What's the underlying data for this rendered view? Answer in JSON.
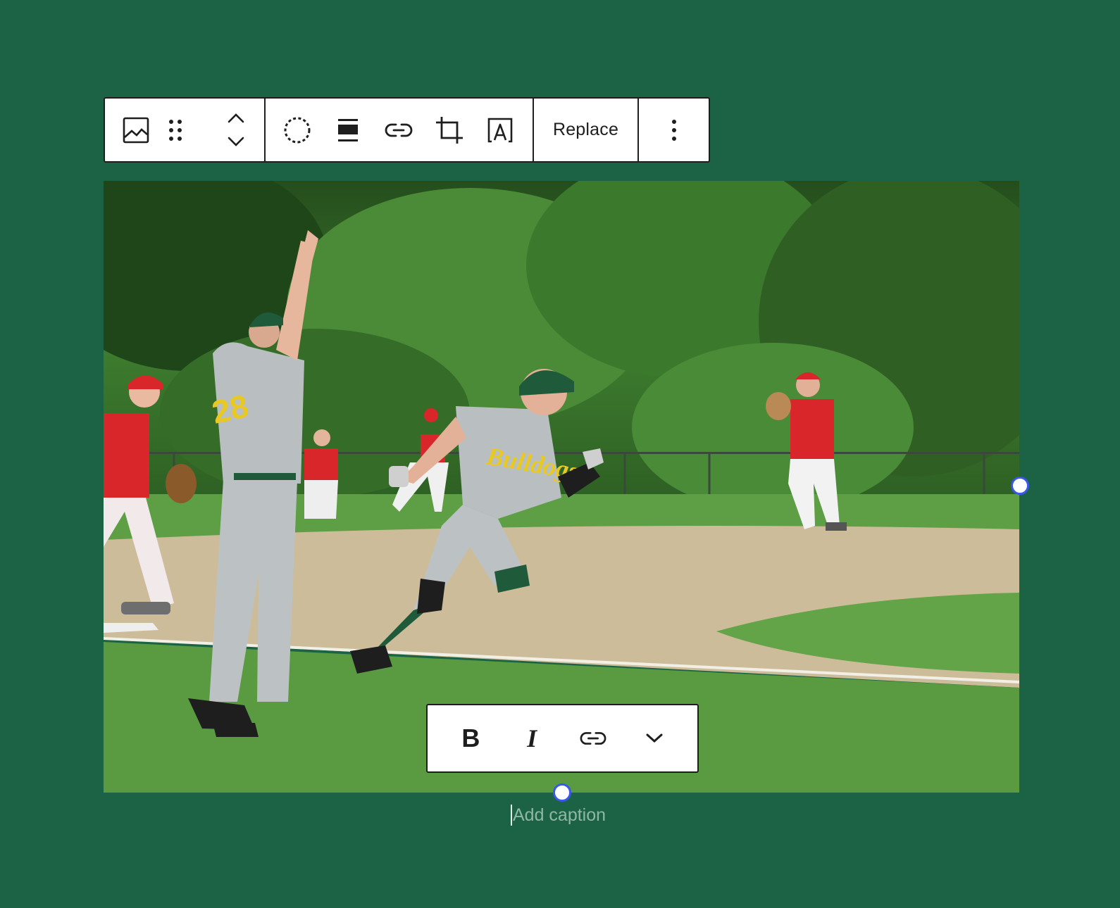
{
  "block_toolbar": {
    "buttons": [
      {
        "icon": "image-block-icon",
        "label": "Image"
      },
      {
        "icon": "drag-handle-icon",
        "label": "Drag"
      },
      {
        "icon": "move-up-down-icon",
        "label": "Move up/down"
      },
      {
        "icon": "select-circle-icon",
        "label": "Apply duotone filter"
      },
      {
        "icon": "align-icon",
        "label": "Align"
      },
      {
        "icon": "link-icon",
        "label": "Insert link"
      },
      {
        "icon": "crop-icon",
        "label": "Crop"
      },
      {
        "icon": "text-overlay-icon",
        "label": "Add text over image"
      }
    ],
    "replace_label": "Replace",
    "more_label": "Options"
  },
  "image": {
    "alt": "",
    "colors": {
      "sky": "#2f5b24",
      "trees": "#3d7a2c",
      "infield": "#cdbc9a",
      "grass": "#5fa045",
      "uniform_gray": "#b9bfc0",
      "uniform_red": "#d8262b",
      "helmet_green": "#1f5a3a"
    }
  },
  "format_toolbar": {
    "bold_label": "B",
    "italic_label": "I",
    "link_icon": "link-icon",
    "more_icon": "chevron-down-icon"
  },
  "caption": {
    "placeholder": "Add caption"
  },
  "colors": {
    "background": "#1c6345",
    "handle": "#3858e9",
    "toolbar_border": "#1e1e1e"
  }
}
